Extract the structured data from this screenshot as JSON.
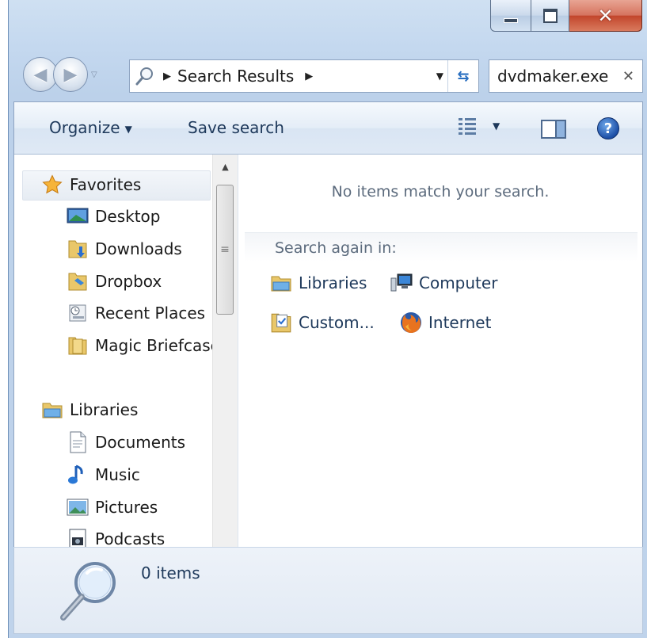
{
  "toolbar": {
    "organize_label": "Organize",
    "save_search_label": "Save search"
  },
  "address": {
    "breadcrumb": "Search Results"
  },
  "search": {
    "value": "dvdmaker.exe"
  },
  "favorites": {
    "header": "Favorites",
    "items": [
      {
        "label": "Desktop",
        "icon": "desktop-icon"
      },
      {
        "label": "Downloads",
        "icon": "downloads-folder-icon"
      },
      {
        "label": "Dropbox",
        "icon": "dropbox-folder-icon"
      },
      {
        "label": "Recent Places",
        "icon": "recent-places-icon"
      },
      {
        "label": "Magic Briefcase",
        "icon": "briefcase-folder-icon"
      }
    ]
  },
  "libraries": {
    "header": "Libraries",
    "items": [
      {
        "label": "Documents",
        "icon": "document-icon"
      },
      {
        "label": "Music",
        "icon": "music-note-icon"
      },
      {
        "label": "Pictures",
        "icon": "picture-icon"
      },
      {
        "label": "Podcasts",
        "icon": "podcast-icon"
      }
    ]
  },
  "content": {
    "empty_message": "No items match your search.",
    "search_again_label": "Search again in:",
    "locations": [
      {
        "label": "Libraries",
        "icon": "libraries-folder-icon"
      },
      {
        "label": "Computer",
        "icon": "computer-icon"
      },
      {
        "label": "Custom...",
        "icon": "custom-folder-icon"
      },
      {
        "label": "Internet",
        "icon": "firefox-icon"
      }
    ]
  },
  "status": {
    "items_count": "0 items"
  },
  "colors": {
    "frame": "#bfd3eb",
    "text": "#1e395b",
    "close": "#c2452b"
  }
}
